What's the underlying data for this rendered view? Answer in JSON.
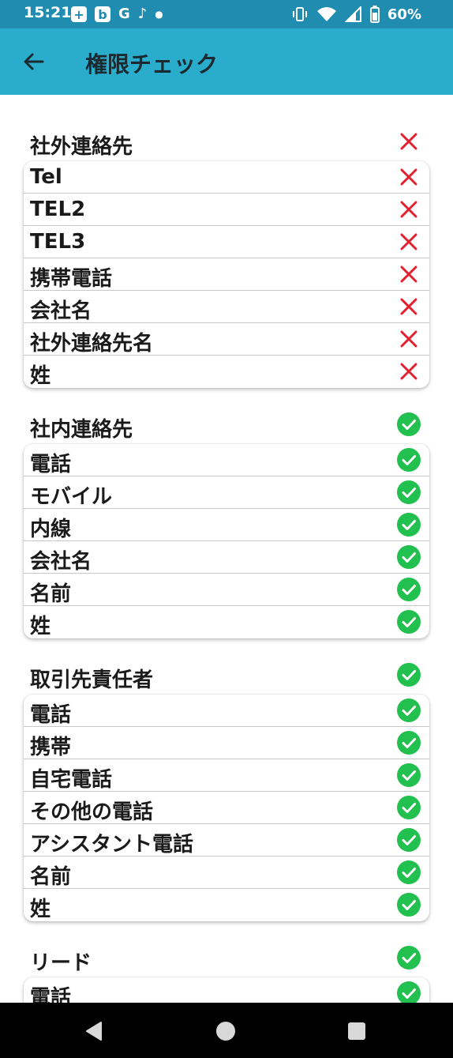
{
  "status_bar": {
    "time": "15:21",
    "battery": "60%",
    "left_icons": [
      "plus-box-icon",
      "b-app-icon",
      "google-icon",
      "music-note-icon",
      "dot-icon"
    ],
    "right_icons": [
      "vibrate-icon",
      "wifi-icon",
      "signal-icon",
      "battery-icon"
    ]
  },
  "app_bar": {
    "title": "権限チェック",
    "back_icon": "arrow-left-icon"
  },
  "colors": {
    "status_bar_bg": "#1f8cb0",
    "app_bar_bg": "#2aadcd",
    "denied": "#e0212f",
    "granted": "#22c14f"
  },
  "sections": [
    {
      "title": "社外連絡先",
      "granted": false,
      "rows": [
        {
          "label": "Tel",
          "granted": false
        },
        {
          "label": "TEL2",
          "granted": false
        },
        {
          "label": "TEL3",
          "granted": false
        },
        {
          "label": "携帯電話",
          "granted": false
        },
        {
          "label": "会社名",
          "granted": false
        },
        {
          "label": "社外連絡先名",
          "granted": false
        },
        {
          "label": "姓",
          "granted": false
        }
      ]
    },
    {
      "title": "社内連絡先",
      "granted": true,
      "rows": [
        {
          "label": "電話",
          "granted": true
        },
        {
          "label": "モバイル",
          "granted": true
        },
        {
          "label": "内線",
          "granted": true
        },
        {
          "label": "会社名",
          "granted": true
        },
        {
          "label": "名前",
          "granted": true
        },
        {
          "label": "姓",
          "granted": true
        }
      ]
    },
    {
      "title": "取引先責任者",
      "granted": true,
      "rows": [
        {
          "label": "電話",
          "granted": true
        },
        {
          "label": "携帯",
          "granted": true
        },
        {
          "label": "自宅電話",
          "granted": true
        },
        {
          "label": "その他の電話",
          "granted": true
        },
        {
          "label": "アシスタント電話",
          "granted": true
        },
        {
          "label": "名前",
          "granted": true
        },
        {
          "label": "姓",
          "granted": true
        }
      ]
    },
    {
      "title": "リード",
      "granted": true,
      "rows": [
        {
          "label": "電話",
          "granted": true
        }
      ]
    }
  ],
  "nav_bar": {
    "buttons": [
      "back-triangle-icon",
      "home-circle-icon",
      "recents-square-icon"
    ]
  }
}
